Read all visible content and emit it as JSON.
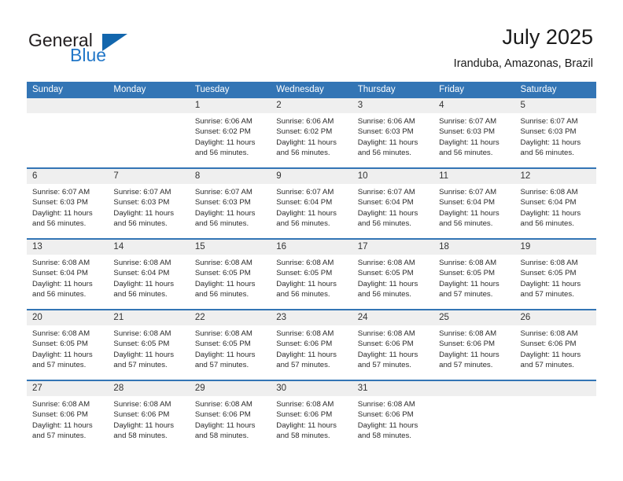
{
  "brand": {
    "word_one": "General",
    "word_two": "Blue",
    "logo_icon": "triangle-icon",
    "color_primary": "#231f20",
    "color_accent": "#2277c8"
  },
  "header": {
    "title": "July 2025",
    "subtitle": "Iranduba, Amazonas, Brazil"
  },
  "theme": {
    "header_blue": "#3375b5",
    "daynum_gray": "#efefef",
    "text": "#2b2b2b"
  },
  "weekdays": [
    "Sunday",
    "Monday",
    "Tuesday",
    "Wednesday",
    "Thursday",
    "Friday",
    "Saturday"
  ],
  "weeks": [
    [
      {
        "day": "",
        "empty": true,
        "sunrise": "",
        "sunset": "",
        "daylight_1": "",
        "daylight_2": ""
      },
      {
        "day": "",
        "empty": true,
        "sunrise": "",
        "sunset": "",
        "daylight_1": "",
        "daylight_2": ""
      },
      {
        "day": "1",
        "sunrise": "Sunrise: 6:06 AM",
        "sunset": "Sunset: 6:02 PM",
        "daylight_1": "Daylight: 11 hours",
        "daylight_2": "and 56 minutes."
      },
      {
        "day": "2",
        "sunrise": "Sunrise: 6:06 AM",
        "sunset": "Sunset: 6:02 PM",
        "daylight_1": "Daylight: 11 hours",
        "daylight_2": "and 56 minutes."
      },
      {
        "day": "3",
        "sunrise": "Sunrise: 6:06 AM",
        "sunset": "Sunset: 6:03 PM",
        "daylight_1": "Daylight: 11 hours",
        "daylight_2": "and 56 minutes."
      },
      {
        "day": "4",
        "sunrise": "Sunrise: 6:07 AM",
        "sunset": "Sunset: 6:03 PM",
        "daylight_1": "Daylight: 11 hours",
        "daylight_2": "and 56 minutes."
      },
      {
        "day": "5",
        "sunrise": "Sunrise: 6:07 AM",
        "sunset": "Sunset: 6:03 PM",
        "daylight_1": "Daylight: 11 hours",
        "daylight_2": "and 56 minutes."
      }
    ],
    [
      {
        "day": "6",
        "sunrise": "Sunrise: 6:07 AM",
        "sunset": "Sunset: 6:03 PM",
        "daylight_1": "Daylight: 11 hours",
        "daylight_2": "and 56 minutes."
      },
      {
        "day": "7",
        "sunrise": "Sunrise: 6:07 AM",
        "sunset": "Sunset: 6:03 PM",
        "daylight_1": "Daylight: 11 hours",
        "daylight_2": "and 56 minutes."
      },
      {
        "day": "8",
        "sunrise": "Sunrise: 6:07 AM",
        "sunset": "Sunset: 6:03 PM",
        "daylight_1": "Daylight: 11 hours",
        "daylight_2": "and 56 minutes."
      },
      {
        "day": "9",
        "sunrise": "Sunrise: 6:07 AM",
        "sunset": "Sunset: 6:04 PM",
        "daylight_1": "Daylight: 11 hours",
        "daylight_2": "and 56 minutes."
      },
      {
        "day": "10",
        "sunrise": "Sunrise: 6:07 AM",
        "sunset": "Sunset: 6:04 PM",
        "daylight_1": "Daylight: 11 hours",
        "daylight_2": "and 56 minutes."
      },
      {
        "day": "11",
        "sunrise": "Sunrise: 6:07 AM",
        "sunset": "Sunset: 6:04 PM",
        "daylight_1": "Daylight: 11 hours",
        "daylight_2": "and 56 minutes."
      },
      {
        "day": "12",
        "sunrise": "Sunrise: 6:08 AM",
        "sunset": "Sunset: 6:04 PM",
        "daylight_1": "Daylight: 11 hours",
        "daylight_2": "and 56 minutes."
      }
    ],
    [
      {
        "day": "13",
        "sunrise": "Sunrise: 6:08 AM",
        "sunset": "Sunset: 6:04 PM",
        "daylight_1": "Daylight: 11 hours",
        "daylight_2": "and 56 minutes."
      },
      {
        "day": "14",
        "sunrise": "Sunrise: 6:08 AM",
        "sunset": "Sunset: 6:04 PM",
        "daylight_1": "Daylight: 11 hours",
        "daylight_2": "and 56 minutes."
      },
      {
        "day": "15",
        "sunrise": "Sunrise: 6:08 AM",
        "sunset": "Sunset: 6:05 PM",
        "daylight_1": "Daylight: 11 hours",
        "daylight_2": "and 56 minutes."
      },
      {
        "day": "16",
        "sunrise": "Sunrise: 6:08 AM",
        "sunset": "Sunset: 6:05 PM",
        "daylight_1": "Daylight: 11 hours",
        "daylight_2": "and 56 minutes."
      },
      {
        "day": "17",
        "sunrise": "Sunrise: 6:08 AM",
        "sunset": "Sunset: 6:05 PM",
        "daylight_1": "Daylight: 11 hours",
        "daylight_2": "and 56 minutes."
      },
      {
        "day": "18",
        "sunrise": "Sunrise: 6:08 AM",
        "sunset": "Sunset: 6:05 PM",
        "daylight_1": "Daylight: 11 hours",
        "daylight_2": "and 57 minutes."
      },
      {
        "day": "19",
        "sunrise": "Sunrise: 6:08 AM",
        "sunset": "Sunset: 6:05 PM",
        "daylight_1": "Daylight: 11 hours",
        "daylight_2": "and 57 minutes."
      }
    ],
    [
      {
        "day": "20",
        "sunrise": "Sunrise: 6:08 AM",
        "sunset": "Sunset: 6:05 PM",
        "daylight_1": "Daylight: 11 hours",
        "daylight_2": "and 57 minutes."
      },
      {
        "day": "21",
        "sunrise": "Sunrise: 6:08 AM",
        "sunset": "Sunset: 6:05 PM",
        "daylight_1": "Daylight: 11 hours",
        "daylight_2": "and 57 minutes."
      },
      {
        "day": "22",
        "sunrise": "Sunrise: 6:08 AM",
        "sunset": "Sunset: 6:05 PM",
        "daylight_1": "Daylight: 11 hours",
        "daylight_2": "and 57 minutes."
      },
      {
        "day": "23",
        "sunrise": "Sunrise: 6:08 AM",
        "sunset": "Sunset: 6:06 PM",
        "daylight_1": "Daylight: 11 hours",
        "daylight_2": "and 57 minutes."
      },
      {
        "day": "24",
        "sunrise": "Sunrise: 6:08 AM",
        "sunset": "Sunset: 6:06 PM",
        "daylight_1": "Daylight: 11 hours",
        "daylight_2": "and 57 minutes."
      },
      {
        "day": "25",
        "sunrise": "Sunrise: 6:08 AM",
        "sunset": "Sunset: 6:06 PM",
        "daylight_1": "Daylight: 11 hours",
        "daylight_2": "and 57 minutes."
      },
      {
        "day": "26",
        "sunrise": "Sunrise: 6:08 AM",
        "sunset": "Sunset: 6:06 PM",
        "daylight_1": "Daylight: 11 hours",
        "daylight_2": "and 57 minutes."
      }
    ],
    [
      {
        "day": "27",
        "sunrise": "Sunrise: 6:08 AM",
        "sunset": "Sunset: 6:06 PM",
        "daylight_1": "Daylight: 11 hours",
        "daylight_2": "and 57 minutes."
      },
      {
        "day": "28",
        "sunrise": "Sunrise: 6:08 AM",
        "sunset": "Sunset: 6:06 PM",
        "daylight_1": "Daylight: 11 hours",
        "daylight_2": "and 58 minutes."
      },
      {
        "day": "29",
        "sunrise": "Sunrise: 6:08 AM",
        "sunset": "Sunset: 6:06 PM",
        "daylight_1": "Daylight: 11 hours",
        "daylight_2": "and 58 minutes."
      },
      {
        "day": "30",
        "sunrise": "Sunrise: 6:08 AM",
        "sunset": "Sunset: 6:06 PM",
        "daylight_1": "Daylight: 11 hours",
        "daylight_2": "and 58 minutes."
      },
      {
        "day": "31",
        "sunrise": "Sunrise: 6:08 AM",
        "sunset": "Sunset: 6:06 PM",
        "daylight_1": "Daylight: 11 hours",
        "daylight_2": "and 58 minutes."
      },
      {
        "day": "",
        "empty": true,
        "sunrise": "",
        "sunset": "",
        "daylight_1": "",
        "daylight_2": ""
      },
      {
        "day": "",
        "empty": true,
        "sunrise": "",
        "sunset": "",
        "daylight_1": "",
        "daylight_2": ""
      }
    ]
  ]
}
